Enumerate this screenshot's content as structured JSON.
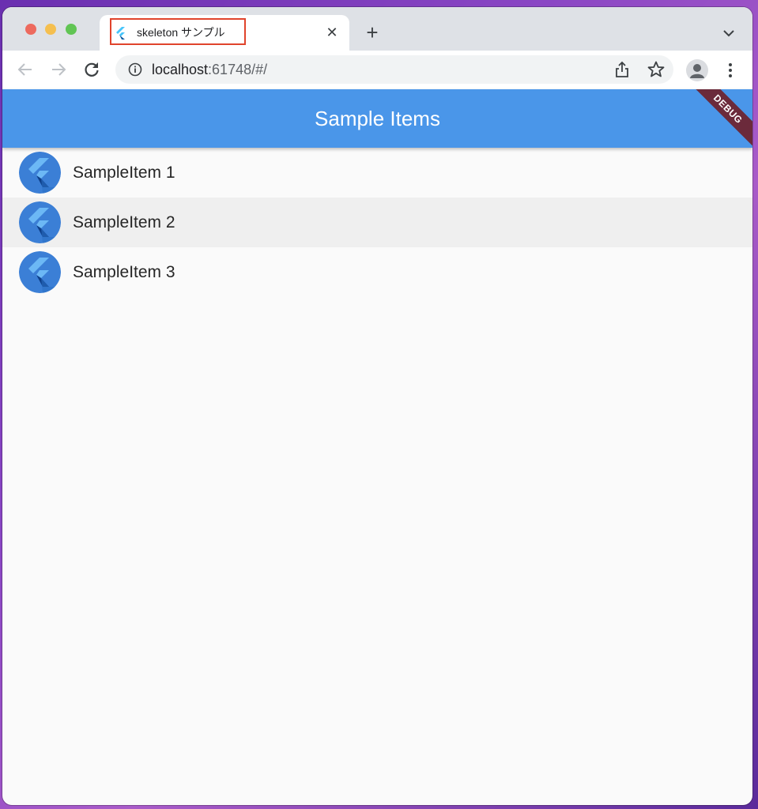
{
  "browser": {
    "tab": {
      "title": "skeleton サンプル",
      "close_label": "✕",
      "favicon": "flutter-logo-icon"
    },
    "new_tab_label": "+",
    "address": {
      "host": "localhost",
      "rest": ":61748/#/"
    },
    "icons": {
      "back": "arrow-left-icon",
      "forward": "arrow-right-icon",
      "reload": "reload-icon",
      "info": "info-icon",
      "share": "share-icon",
      "bookmark": "star-icon",
      "profile": "person-icon",
      "menu": "three-dots-icon",
      "tab_search": "chevron-down-icon"
    },
    "colors": {
      "tab_highlight_border": "#e0442c"
    }
  },
  "app": {
    "title": "Sample Items",
    "debug_banner": "DEBUG",
    "colors": {
      "app_bar": "#4a96e9",
      "debug_banner": "#6b2a3b",
      "hover_row": "#efefef"
    },
    "items": [
      {
        "label": "SampleItem 1",
        "icon": "flutter-logo-icon"
      },
      {
        "label": "SampleItem 2",
        "icon": "flutter-logo-icon"
      },
      {
        "label": "SampleItem 3",
        "icon": "flutter-logo-icon"
      }
    ]
  }
}
